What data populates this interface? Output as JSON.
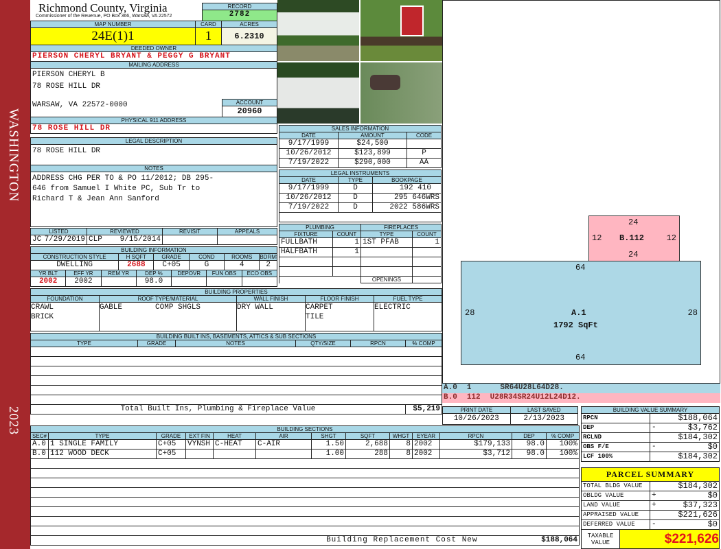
{
  "side": {
    "label": "WASHINGTON",
    "year": "2023",
    "color": "#a5282c"
  },
  "header": {
    "title": "Richmond County, Virginia",
    "subtitle": "Commissioner of the Reuenue, PO Box 366, Warsaw, VA 22572",
    "record_label": "RECORD",
    "record": "2782"
  },
  "parcel": {
    "map_label": "MAP NUMBER",
    "map": "24E(1)1",
    "card_label": "CARD",
    "card": "1",
    "acres_label": "ACRES",
    "acres": "6.2310"
  },
  "owner": {
    "label": "DEEDED OWNER",
    "value": "PIERSON CHERYL BRYANT & PEGGY G BRYANT"
  },
  "mailing": {
    "label": "MAILING ADDRESS",
    "line1": "PIERSON CHERYL B",
    "line2": "78 ROSE HILL DR",
    "line3": "WARSAW, VA 22572-0000",
    "account_label": "ACCOUNT",
    "account": "20960"
  },
  "physical": {
    "label": "PHYSICAL 911 ADDRESS",
    "value": "78 ROSE HILL DR"
  },
  "legal": {
    "label": "LEGAL DESCRIPTION",
    "value": "78 ROSE HILL DR"
  },
  "notes": {
    "label": "NOTES",
    "value": "ADDRESS CHG PER TO & PO 11/2012; DB 295-\n646 from Samuel I White PC, Sub Tr to\nRichard T & Jean Ann Sanford"
  },
  "review": {
    "headers": [
      "LISTED",
      "REVIEWED",
      "REVISIT",
      "APPEALS"
    ],
    "listed_by": "JC",
    "listed": "7/29/2019",
    "reviewed_by": "CLP",
    "reviewed": "9/15/2014"
  },
  "building_info": {
    "label": "BUILDING INFORMATION",
    "h1": [
      "CONSTRUCTION STYLE",
      "H SQFT",
      "GRADE",
      "COND",
      "ROOMS",
      "BDRMS"
    ],
    "v1": [
      "DWELLING",
      "2688",
      "C+05",
      "G",
      "4",
      "2"
    ],
    "h2": [
      "YR BLT",
      "EFF YR",
      "REM YR",
      "DEP %",
      "DEPOVR",
      "FUN OBS",
      "ECO OBS"
    ],
    "v2": [
      "2002",
      "2002",
      "",
      "98.0",
      "",
      "",
      ""
    ]
  },
  "properties": {
    "label": "BUILDING PROPERTIES",
    "headers": [
      "FOUNDATION",
      "ROOF TYPE/MATERIAL",
      "WALL FINISH",
      "FLOOR FINISH",
      "FUEL TYPE"
    ],
    "foundation": [
      "CRAWL",
      "BRICK"
    ],
    "roof_type": "GABLE",
    "roof_material": "COMP SHGLS",
    "wall": "DRY WALL",
    "floor": [
      "CARPET",
      "TILE"
    ],
    "fuel": "ELECTRIC"
  },
  "builtins": {
    "label": "BUILDING BUILT INS, BASEMENTS, ATTICS & SUB SECTIONS",
    "headers": [
      "TYPE",
      "GRADE",
      "NOTES",
      "QTY/SIZE",
      "RPCN",
      "% COMP"
    ],
    "total_label": "Total Built Ins, Plumbing & Fireplace Value",
    "total": "$5,219"
  },
  "sales": {
    "label": "SALES INFORMATION",
    "headers": [
      "DATE",
      "AMOUNT",
      "CODE"
    ],
    "rows": [
      [
        "9/17/1999",
        "$24,500",
        ""
      ],
      [
        "10/26/2012",
        "$123,899",
        "P"
      ],
      [
        "7/19/2022",
        "$290,000",
        "AA"
      ]
    ]
  },
  "instruments": {
    "label": "LEGAL INSTRUMENTS",
    "headers": [
      "DATE",
      "TYPE",
      "BOOKPAGE"
    ],
    "rows": [
      [
        "9/17/1999",
        "D",
        "192 410"
      ],
      [
        "10/26/2012",
        "D",
        "295 646WRS"
      ],
      [
        "7/19/2022",
        "D",
        "2022 586WRS"
      ]
    ]
  },
  "plumbing": {
    "label": "PLUMBING",
    "headers": [
      "FIXTURE",
      "COUNT"
    ],
    "rows": [
      [
        "FULLBATH",
        "1"
      ],
      [
        "HALFBATH",
        "1"
      ]
    ]
  },
  "fireplaces": {
    "label": "FIREPLACES",
    "headers": [
      "TYPE",
      "COUNT"
    ],
    "rows": [
      [
        "1ST PFAB",
        "1"
      ]
    ],
    "openings_label": "OPENINGS"
  },
  "sketch": {
    "a": {
      "label": "A.1",
      "area": "1792 SqFt",
      "top": "64",
      "bottom": "64",
      "left": "28",
      "right": "28",
      "color": "#add8e6"
    },
    "b": {
      "label": "B.112",
      "top": "24",
      "bottom": "24",
      "left": "12",
      "right": "12",
      "color": "#ffb6c1"
    },
    "legend": [
      [
        "A.0",
        "1",
        "SR64U28L64D28."
      ],
      [
        "B.0",
        "112",
        "U28R34SR24U12L24D12."
      ]
    ]
  },
  "dates": {
    "print_label": "PRINT DATE",
    "print": "10/26/2023",
    "saved_label": "LAST SAVED",
    "saved": "2/13/2023"
  },
  "sections": {
    "label": "BUILDING SECTIONS",
    "headers": [
      "SEC#",
      "TYPE",
      "GRADE",
      "EXT FIN",
      "HEAT",
      "AIR",
      "SHGT",
      "SQFT",
      "WHGT",
      "EYEAR",
      "RPCN",
      "DEP",
      "% COMP"
    ],
    "rows": [
      [
        "A.0",
        "1 SINGLE FAMILY",
        "C+05",
        "VYNSH",
        "C-HEAT",
        "C-AIR",
        "1.50",
        "2,688",
        "8",
        "2002",
        "$179,133",
        "98.0",
        "100%"
      ],
      [
        "B.0",
        "112 WOOD DECK",
        "C+05",
        "",
        "",
        "",
        "1.00",
        "288",
        "8",
        "2002",
        "$3,712",
        "98.0",
        "100%"
      ]
    ],
    "total_label": "Building Replacement Cost New",
    "total": "$188,064"
  },
  "value_summary": {
    "label": "BUILDING VALUE SUMMARY",
    "rows": [
      [
        "RPCN",
        "",
        "$188,064"
      ],
      [
        "DEP",
        "-",
        "$3,762"
      ],
      [
        "RCLND",
        "",
        "$184,302"
      ],
      [
        "OBS F/E",
        "-",
        "$0"
      ],
      [
        "LCF 100%",
        "",
        "$184,302"
      ]
    ]
  },
  "parcel_summary": {
    "label": "PARCEL SUMMARY",
    "rows": [
      [
        "TOTAL BLDG VALUE",
        "",
        "$184,302"
      ],
      [
        "OBLDG VALUE",
        "+",
        "$0"
      ],
      [
        "LAND VALUE",
        "+",
        "$37,323"
      ],
      [
        "APPRAISED VALUE",
        "",
        "$221,626"
      ],
      [
        "DEFERRED VALUE",
        "-",
        "$0"
      ]
    ],
    "taxable_label": "TAXABLE VALUE",
    "taxable": "$221,626"
  },
  "photos": [
    "house-front-photo",
    "realty-sign-photo",
    "house-side-photo",
    "mailbox-photo"
  ]
}
